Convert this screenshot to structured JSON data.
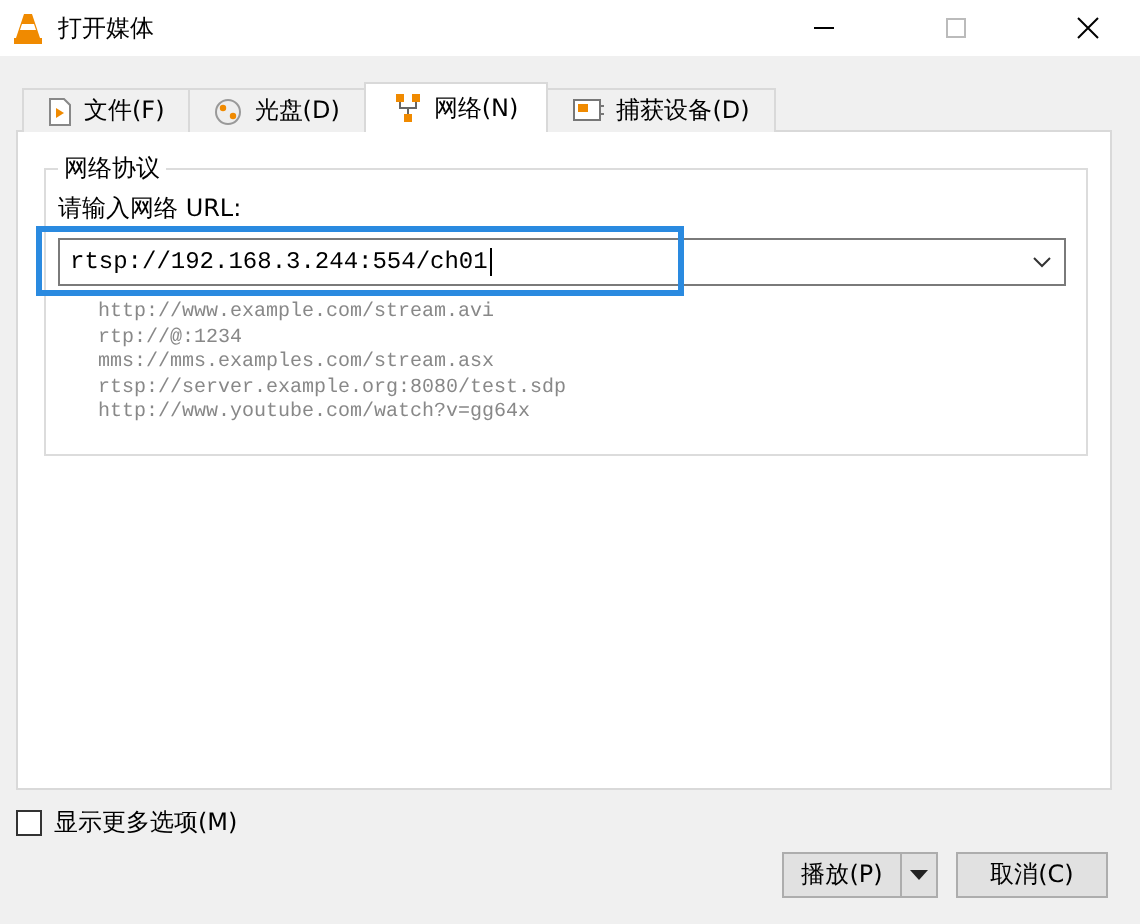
{
  "window": {
    "title": "打开媒体"
  },
  "tabs": [
    {
      "label": "文件(F)",
      "kind": "file",
      "selected": false
    },
    {
      "label": "光盘(D)",
      "kind": "disc",
      "selected": false
    },
    {
      "label": "网络(N)",
      "kind": "network",
      "selected": true
    },
    {
      "label": "捕获设备(D)",
      "kind": "capture",
      "selected": false
    }
  ],
  "group": {
    "title": "网络协议",
    "prompt": "请输入网络 URL:",
    "url": {
      "value": "rtsp://192.168.3.244:554/ch01",
      "highlighted": true
    },
    "examples": [
      "http://www.example.com/stream.avi",
      "rtp://@:1234",
      "mms://mms.examples.com/stream.asx",
      "rtsp://server.example.org:8080/test.sdp",
      "http://www.youtube.com/watch?v=gg64x"
    ]
  },
  "more_options": {
    "label": "显示更多选项(M)",
    "checked": false
  },
  "buttons": [
    {
      "label": "播放(P)",
      "kind": "split"
    },
    {
      "label": "取消(C)",
      "kind": "plain"
    }
  ]
}
